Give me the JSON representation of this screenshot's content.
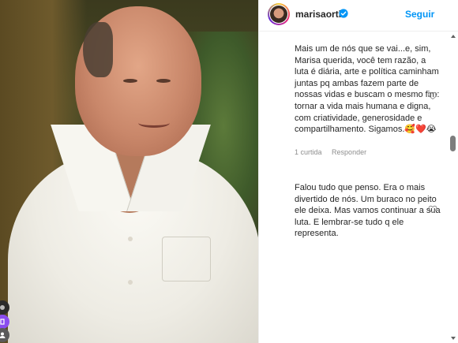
{
  "post": {
    "username": "marisaorth",
    "verified": true,
    "follow_label": "Seguir"
  },
  "comments": [
    {
      "text": "Mais um de nós que se vai...e, sim, Marisa querida, você tem razão, a luta é diária, arte e política caminham juntas pq ambas fazem parte de nossas vidas e buscam o mesmo fim: tornar a vida mais humana e digna, com criatividade, generosidade e compartilhamento. Sigamos.🥰❤️😭",
      "likes": "1 curtida",
      "reply": "Responder"
    },
    {
      "text": "Falou tudo que penso. Era o mais divertido de nós. Um buraco no peito ele deixa. Mas vamos continuar a sua luta. E lembrar-se tudo q ele representa."
    }
  ],
  "icons": {
    "verified": "verified-badge-icon",
    "like": "heart-outline-icon",
    "avatar": "profile-avatar"
  },
  "colors": {
    "accent": "#0095f6",
    "text": "#262626",
    "muted": "#8e8e8e"
  }
}
